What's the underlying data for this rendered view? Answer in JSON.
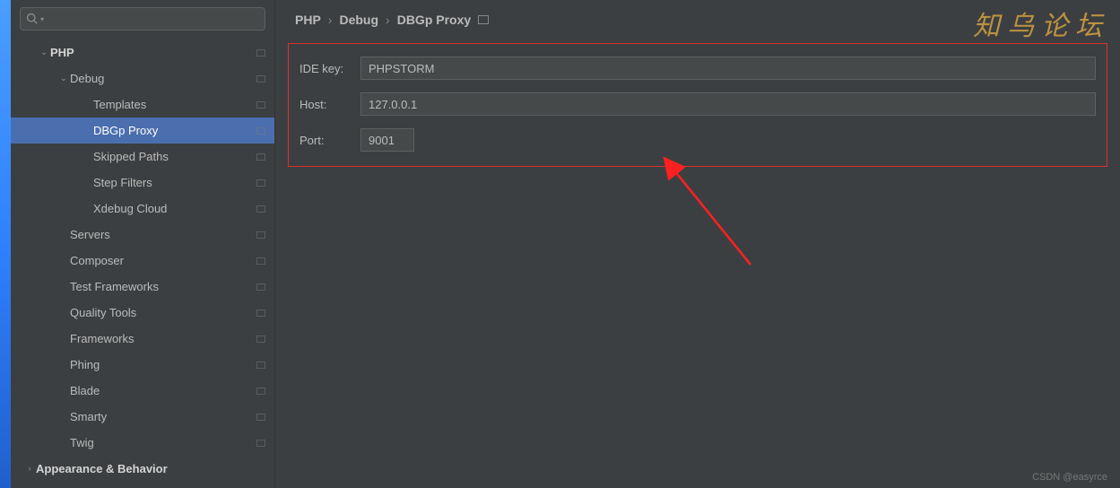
{
  "search": {
    "placeholder": ""
  },
  "tree": [
    {
      "label": "PHP",
      "level": 1,
      "expanded": true,
      "bold": true,
      "hasBadge": true
    },
    {
      "label": "Debug",
      "level": 2,
      "expanded": true,
      "hasBadge": true
    },
    {
      "label": "Templates",
      "level": 3,
      "hasBadge": true
    },
    {
      "label": "DBGp Proxy",
      "level": 3,
      "hasBadge": true,
      "selected": true
    },
    {
      "label": "Skipped Paths",
      "level": 3,
      "hasBadge": true
    },
    {
      "label": "Step Filters",
      "level": 3,
      "hasBadge": true
    },
    {
      "label": "Xdebug Cloud",
      "level": 3,
      "hasBadge": true
    },
    {
      "label": "Servers",
      "level": 2,
      "hasBadge": true
    },
    {
      "label": "Composer",
      "level": 2,
      "hasBadge": true
    },
    {
      "label": "Test Frameworks",
      "level": 2,
      "hasBadge": true
    },
    {
      "label": "Quality Tools",
      "level": 2,
      "hasBadge": true
    },
    {
      "label": "Frameworks",
      "level": 2,
      "hasBadge": true
    },
    {
      "label": "Phing",
      "level": 2,
      "hasBadge": true
    },
    {
      "label": "Blade",
      "level": 2,
      "hasBadge": true
    },
    {
      "label": "Smarty",
      "level": 2,
      "hasBadge": true
    },
    {
      "label": "Twig",
      "level": 2,
      "hasBadge": true
    },
    {
      "label": "Appearance & Behavior",
      "level": 0,
      "collapsed": true,
      "bold": true
    }
  ],
  "breadcrumb": [
    "PHP",
    "Debug",
    "DBGp Proxy"
  ],
  "form": {
    "ide_key_label": "IDE key:",
    "ide_key_value": "PHPSTORM",
    "host_label": "Host:",
    "host_value": "127.0.0.1",
    "port_label": "Port:",
    "port_value": "9001"
  },
  "watermark_cn": "知乌论坛",
  "watermark_csdn": "CSDN @easyrce"
}
